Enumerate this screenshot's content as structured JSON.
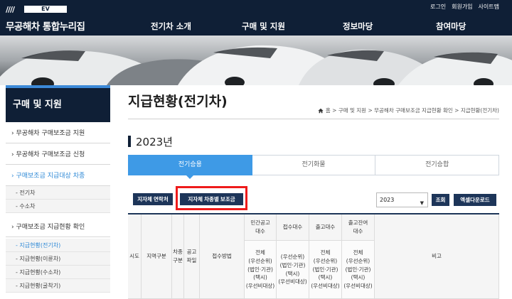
{
  "header": {
    "logo_slashes": "////",
    "logo_badge": "EV",
    "logo_name": "무공해차 통합누리집",
    "util_links": [
      "로그인",
      "회원가입",
      "사이트맵"
    ],
    "gnb": [
      "전기차 소개",
      "구매 및 지원",
      "정보마당",
      "참여마당"
    ]
  },
  "sidebar": {
    "title": "구매 및 지원",
    "items": [
      {
        "label": "› 무공해차 구매보조금 지원"
      },
      {
        "label": "› 무공해차 구매보조금 신청"
      },
      {
        "label": "› 구매보조금 지급대상 차종"
      },
      {
        "label": "› 구매보조금 지급현황 확인"
      }
    ],
    "sub_a": [
      "- 전기차",
      "- 수소차"
    ],
    "sub_b": [
      "- 지급현황(전기차)",
      "- 지급현황(이륜차)",
      "- 지급현황(수소차)",
      "- 지급현황(굴착기)"
    ]
  },
  "main": {
    "title": "지급현황(전기차)",
    "breadcrumb": "홈 > 구매 및 지원 > 무공해차 구매보조금 지급현황 확인 > 지급현황(전기차)",
    "year_heading": "2023년",
    "tabs": [
      "전기승용",
      "전기화물",
      "전기승합"
    ],
    "buttons": {
      "contacts": "지자체 연락처",
      "subsidy_by_model": "지자체 차종별 보조금",
      "search": "조회",
      "excel": "엑셀다운로드"
    },
    "year_select": "2023",
    "table": {
      "headers": [
        "시도",
        "지역구분",
        "차종구분",
        "공고파일",
        "접수방법",
        "민간공고대수",
        "접수대수",
        "출고대수",
        "출고잔여대수",
        "비고"
      ],
      "header_texts": {
        "car_type": "차종\n구분",
        "notice_file": "공고\n파일",
        "notice_count": "민간공고\n대수",
        "remain_count": "출고잔여\n대수"
      },
      "sub_headers": [
        "전체\n(우선순위)\n(법인·기관)\n(택시)\n(우선비대상)",
        "(우선순위)\n(법인·기관)\n(택시)\n(우선비대상)",
        "전체\n(우선순위)\n(법인·기관)\n(택시)\n(우선비대상)",
        "전체\n(우선순위)\n(법인·기관)\n(택시)\n(우선비대상)"
      ]
    }
  },
  "colors": {
    "header_bg": "#0f1f36",
    "tab_active": "#3e9ae6",
    "button_dark": "#1d3559",
    "highlight_box": "#ee1b1b",
    "sidebar_active": "#2e89d6"
  },
  "icons": [
    "home-icon",
    "chevron-down-icon"
  ]
}
